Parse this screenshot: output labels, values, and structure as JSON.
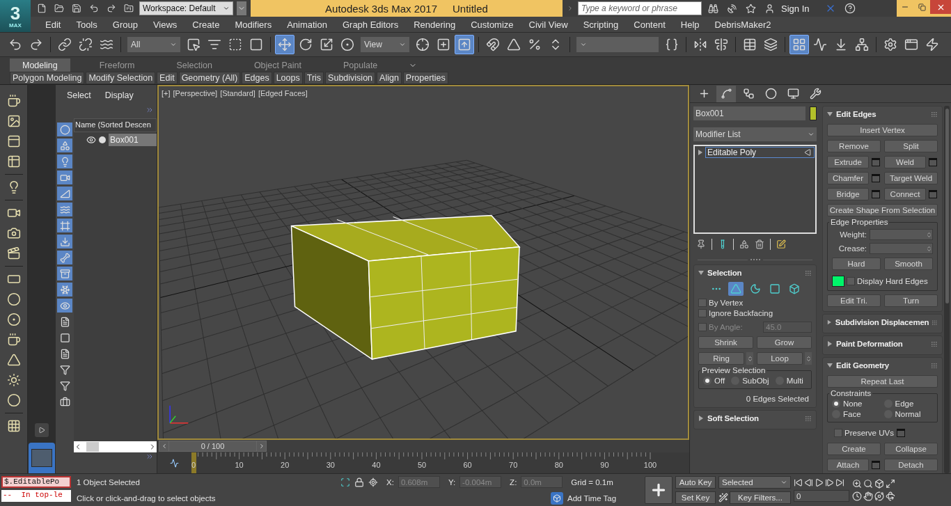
{
  "logo": {
    "numeral": "3",
    "word": "MAX"
  },
  "title_bar": {
    "workspace": "Workspace: Default",
    "app_name": "Autodesk 3ds Max 2017",
    "document": "Untitled",
    "search": {
      "placeholder": "Type a keyword or phrase"
    },
    "sign_in": "Sign In"
  },
  "menu_bar": [
    "Edit",
    "Tools",
    "Group",
    "Views",
    "Create",
    "Modifiers",
    "Animation",
    "Graph Editors",
    "Rendering",
    "Customize",
    "Civil View",
    "Scripting",
    "Content",
    "Help",
    "DebrisMaker2"
  ],
  "main_toolbar": {
    "selection_filter": "All",
    "reference_coordinate": "View",
    "buttons": [
      {
        "selected": false
      },
      {
        "selected": false
      },
      {
        "selected": false
      },
      {
        "selected": false
      },
      {
        "selected": false
      },
      {
        "selected": false
      },
      {
        "selected": false
      },
      {
        "selected": false
      },
      {
        "selected": false
      },
      {
        "selected": true
      },
      {
        "selected": false
      },
      {
        "selected": false
      },
      {
        "selected": false
      },
      {
        "selected": false
      },
      {
        "selected": false
      },
      {
        "selected": true
      },
      {
        "selected": false
      },
      {
        "selected": false
      },
      {
        "selected": false
      },
      {
        "selected": false
      },
      {
        "selected": false
      },
      {
        "selected": false
      },
      {
        "selected": false
      },
      {
        "selected": false
      },
      {
        "selected": false
      },
      {
        "selected": true
      },
      {
        "selected": false
      },
      {
        "selected": false
      },
      {
        "selected": false
      },
      {
        "selected": false
      },
      {
        "selected": false
      },
      {
        "selected": false
      }
    ]
  },
  "ribbon": {
    "tabs": [
      {
        "label": "Modeling",
        "selected": true
      },
      {
        "label": "Freeform",
        "selected": false
      },
      {
        "label": "Selection",
        "selected": false
      },
      {
        "label": "Object Paint",
        "selected": false
      },
      {
        "label": "Populate",
        "selected": false
      }
    ],
    "panels": [
      "Polygon Modeling",
      "Modify Selection",
      "Edit",
      "Geometry (All)",
      "Edges",
      "Loops",
      "Tris",
      "Subdivision",
      "Align",
      "Properties"
    ]
  },
  "scene_explorer": {
    "tabs": [
      "Select",
      "Display"
    ],
    "column": "Name (Sorted Descen",
    "objects": [
      {
        "name": "Box001",
        "selected": true
      }
    ],
    "filters": [
      {
        "on": true
      },
      {
        "on": true
      },
      {
        "on": true
      },
      {
        "on": true
      },
      {
        "on": true
      },
      {
        "on": true
      },
      {
        "on": true
      },
      {
        "on": true
      },
      {
        "on": true
      },
      {
        "on": true
      },
      {
        "on": true
      },
      {
        "on": true
      },
      {
        "on": false
      },
      {
        "on": false
      },
      {
        "on": false
      },
      {
        "on": false
      },
      {
        "on": false
      },
      {
        "on": false
      }
    ]
  },
  "viewport": {
    "labels": [
      "[+]",
      "[Perspective]",
      "[Standard]",
      "[Edged Faces]"
    ]
  },
  "time_slider": {
    "label": "0 / 100",
    "ticks": [
      "0",
      "10",
      "20",
      "30",
      "40",
      "50",
      "60",
      "70",
      "80",
      "90",
      "100"
    ]
  },
  "command_panel": {
    "tabs": [
      {
        "selected": false
      },
      {
        "selected": true
      },
      {
        "selected": false
      },
      {
        "selected": false
      },
      {
        "selected": false
      },
      {
        "selected": false
      }
    ],
    "object": {
      "name": "Box001",
      "color": "#b2c02a"
    },
    "modifier_list": "Modifier List",
    "stack": [
      {
        "name": "Editable Poly",
        "selected": true
      }
    ]
  },
  "selection": {
    "title": "Selection",
    "expanded": true,
    "levels": [
      {
        "selected": false
      },
      {
        "selected": true
      },
      {
        "selected": false
      },
      {
        "selected": false
      },
      {
        "selected": false
      }
    ],
    "options": [
      {
        "label": "By Vertex",
        "checked": false,
        "disabled": false
      },
      {
        "label": "Ignore Backfacing",
        "checked": false,
        "disabled": false
      },
      {
        "label": "By Angle:",
        "checked": false,
        "disabled": true
      }
    ],
    "angle": "45.0",
    "buttons": [
      {
        "label": "Shrink",
        "kind": "half"
      },
      {
        "label": "Grow",
        "kind": "half"
      },
      {
        "label": "Ring",
        "kind": "spinner"
      },
      {
        "label": "Loop",
        "kind": "spinner"
      }
    ],
    "preview": {
      "title": "Preview Selection",
      "options": [
        {
          "label": "Off",
          "selected": true
        },
        {
          "label": "SubObj",
          "selected": false
        },
        {
          "label": "Multi",
          "selected": false
        }
      ]
    },
    "status": "0 Edges Selected"
  },
  "soft_selection": {
    "title": "Soft Selection",
    "expanded": false
  },
  "edit_edges": {
    "title": "Edit Edges",
    "expanded": true,
    "buttons": [
      {
        "label": "Insert Vertex",
        "kind": "wide"
      },
      {
        "label": "Remove",
        "kind": "half"
      },
      {
        "label": "Split",
        "kind": "half"
      },
      {
        "label": "Extrude",
        "kind": "settings"
      },
      {
        "label": "Weld",
        "kind": "settings"
      },
      {
        "label": "Chamfer",
        "kind": "settings"
      },
      {
        "label": "Target Weld",
        "kind": "half"
      },
      {
        "label": "Bridge",
        "kind": "settings"
      },
      {
        "label": "Connect",
        "kind": "settings"
      },
      {
        "label": "Create Shape From Selection",
        "kind": "wide"
      }
    ],
    "edge_properties": {
      "title": "Edge Properties",
      "fields": [
        "Weight:",
        "Crease:"
      ],
      "buttons": [
        "Hard",
        "Smooth"
      ],
      "color": "#00f56a",
      "display_hard_edges": {
        "label": "Display Hard Edges",
        "checked": false
      }
    },
    "bottom_buttons": [
      "Edit Tri.",
      "Turn"
    ]
  },
  "collapsed_rollouts": [
    {
      "title": "Subdivision Displacemen",
      "expanded": false
    },
    {
      "title": "Paint Deformation",
      "expanded": false
    }
  ],
  "edit_geometry": {
    "title": "Edit Geometry",
    "expanded": true,
    "repeat_last": "Repeat Last",
    "constraints": {
      "title": "Constraints",
      "options": [
        {
          "label": "None",
          "selected": true
        },
        {
          "label": "Edge",
          "selected": false
        },
        {
          "label": "Face",
          "selected": false
        },
        {
          "label": "Normal",
          "selected": false
        }
      ]
    },
    "preserve_uvs": {
      "label": "Preserve UVs",
      "checked": false
    },
    "buttons": [
      {
        "label": "Create",
        "kind": "half"
      },
      {
        "label": "Collapse",
        "kind": "half"
      },
      {
        "label": "Attach",
        "kind": "settings"
      },
      {
        "label": "Detach",
        "kind": "half"
      }
    ]
  },
  "status_bar": {
    "listener": [
      "$.EditablePo",
      "--  In top-le"
    ],
    "selection": "1 Object Selected",
    "prompt": "Click or click-and-drag to select objects",
    "coordinates": [
      {
        "label": "X:",
        "value": "0.608m"
      },
      {
        "label": "Y:",
        "value": "-0.004m"
      },
      {
        "label": "Z:",
        "value": "0.0m"
      }
    ],
    "grid": "Grid = 0.1m",
    "add_time_tag": "Add Time Tag",
    "auto_key": "Auto Key",
    "set_key": "Set Key",
    "key_mode": "Selected",
    "key_filters": "Key Filters...",
    "current_frame": "0"
  }
}
